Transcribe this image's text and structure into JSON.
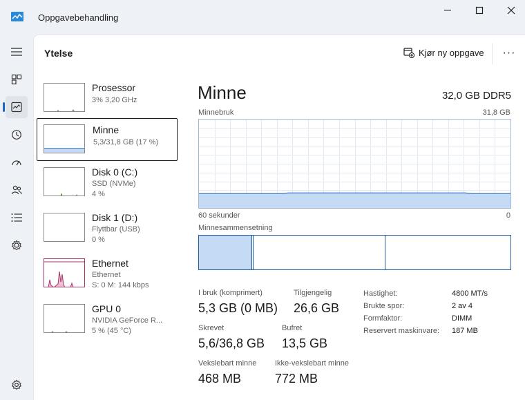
{
  "window": {
    "title": "Oppgavebehandling",
    "icon": "task-manager-icon"
  },
  "nav": {
    "items": [
      {
        "name": "nav-menu-button",
        "icon": "hamburger-icon"
      },
      {
        "name": "nav-processes",
        "icon": "processes-icon"
      },
      {
        "name": "nav-performance",
        "icon": "performance-icon"
      },
      {
        "name": "nav-app-history",
        "icon": "history-icon"
      },
      {
        "name": "nav-startup",
        "icon": "startup-icon"
      },
      {
        "name": "nav-users",
        "icon": "users-icon"
      },
      {
        "name": "nav-details",
        "icon": "list-icon"
      },
      {
        "name": "nav-services",
        "icon": "services-icon"
      },
      {
        "name": "nav-settings",
        "icon": "gear-icon"
      }
    ],
    "active_index": 2
  },
  "header": {
    "title": "Ytelse",
    "new_task_label": "Kjør ny oppgave",
    "more_label": "···"
  },
  "resources": [
    {
      "name": "Prosessor",
      "sub1": "3% 3,20 GHz",
      "sub2": "",
      "sub3": ""
    },
    {
      "name": "Minne",
      "sub1": "5,3/31,8 GB (17 %)",
      "sub2": "",
      "sub3": ""
    },
    {
      "name": "Disk 0 (C:)",
      "sub1": "SSD (NVMe)",
      "sub2": "4 %",
      "sub3": ""
    },
    {
      "name": "Disk 1 (D:)",
      "sub1": "Flyttbar (USB)",
      "sub2": "0 %",
      "sub3": ""
    },
    {
      "name": "Ethernet",
      "sub1": "Ethernet",
      "sub2": "S: 0 M: 144 kbps",
      "sub3": ""
    },
    {
      "name": "GPU 0",
      "sub1": "NVIDIA GeForce R...",
      "sub2": "5 % (45 °C)",
      "sub3": ""
    }
  ],
  "detail": {
    "title": "Minne",
    "spec": "32,0 GB DDR5",
    "usage_label": "Minnebruk",
    "usage_max": "31,8 GB",
    "time_left": "60 sekunder",
    "time_right": "0",
    "usage_fraction": 0.17,
    "composition_label": "Minnesammensetning",
    "composition": {
      "in_use_fraction": 0.17,
      "modified_fraction": 0.004,
      "standby_fraction": 0.424
    }
  },
  "stats": {
    "in_use_label": "I bruk (komprimert)",
    "in_use_value": "5,3 GB (0 MB)",
    "available_label": "Tilgjengelig",
    "available_value": "26,6 GB",
    "committed_label": "Skrevet",
    "committed_value": "5,6/36,8 GB",
    "cached_label": "Bufret",
    "cached_value": "13,5 GB",
    "paged_label": "Vekslebart minne",
    "paged_value": "468 MB",
    "nonpaged_label": "Ikke-vekslebart minne",
    "nonpaged_value": "772 MB"
  },
  "specs": [
    {
      "key": "Hastighet:",
      "value": "4800 MT/s"
    },
    {
      "key": "Brukte spor:",
      "value": "2 av 4"
    },
    {
      "key": "Formfaktor:",
      "value": "DIMM"
    },
    {
      "key": "Reservert maskinvare:",
      "value": "187 MB"
    }
  ],
  "colors": {
    "accent": "#1a67c6",
    "memory_fill": "#c5dbf5",
    "memory_line": "#3b78c2",
    "ethernet": "#a8336a",
    "cpu": "#3b78c2",
    "disk": "#5aa13b",
    "gpu": "#3b78c2"
  }
}
